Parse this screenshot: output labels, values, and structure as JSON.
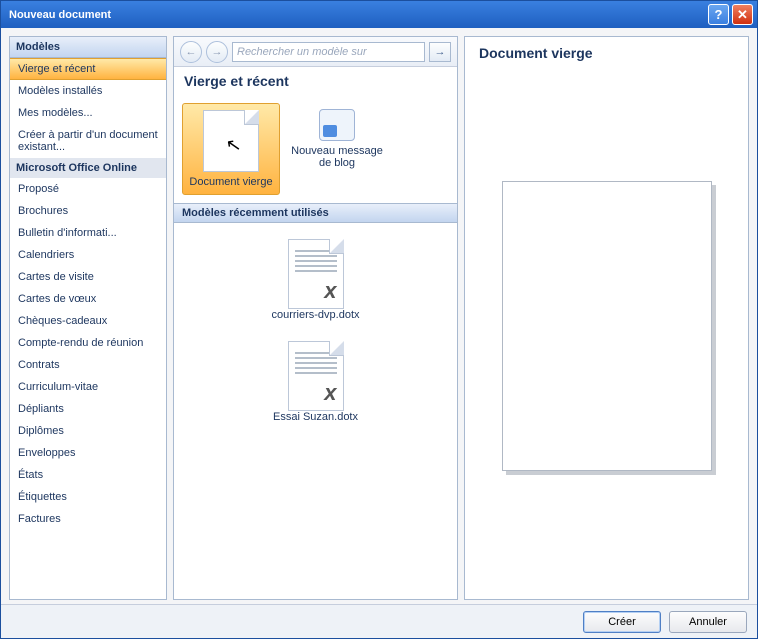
{
  "window": {
    "title": "Nouveau document"
  },
  "sidebar": {
    "header": "Modèles",
    "items_top": [
      "Vierge et récent",
      "Modèles installés",
      "Mes modèles...",
      "Créer à partir d'un document existant..."
    ],
    "selected_top_index": 0,
    "subheader": "Microsoft Office Online",
    "items_online": [
      "Proposé",
      "Brochures",
      "Bulletin d'informati...",
      "Calendriers",
      "Cartes de visite",
      "Cartes de vœux",
      "Chèques-cadeaux",
      "Compte-rendu de réunion",
      "Contrats",
      "Curriculum-vitae",
      "Dépliants",
      "Diplômes",
      "Enveloppes",
      "États",
      "Étiquettes",
      "Factures"
    ]
  },
  "center": {
    "search_placeholder": "Rechercher un modèle sur",
    "section_title": "Vierge et récent",
    "templates": [
      {
        "label": "Document vierge",
        "selected": true,
        "kind": "blank"
      },
      {
        "label": "Nouveau message de blog",
        "selected": false,
        "kind": "blog"
      }
    ],
    "recent_header": "Modèles récemment utilisés",
    "recent": [
      {
        "label": "courriers-dvp.dotx"
      },
      {
        "label": "Essai Suzan.dotx"
      }
    ]
  },
  "preview": {
    "title": "Document vierge"
  },
  "footer": {
    "create": "Créer",
    "cancel": "Annuler"
  }
}
